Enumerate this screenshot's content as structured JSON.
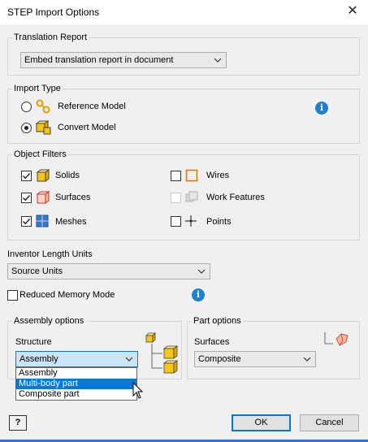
{
  "window": {
    "title": "STEP Import Options"
  },
  "translation_report": {
    "legend": "Translation Report",
    "selected": "Embed translation report in document"
  },
  "import_type": {
    "legend": "Import Type",
    "options": [
      {
        "label": "Reference Model",
        "selected": false
      },
      {
        "label": "Convert Model",
        "selected": true
      }
    ]
  },
  "object_filters": {
    "legend": "Object Filters",
    "items": [
      {
        "label": "Solids",
        "checked": true,
        "enabled": true
      },
      {
        "label": "Surfaces",
        "checked": true,
        "enabled": true
      },
      {
        "label": "Meshes",
        "checked": true,
        "enabled": true
      },
      {
        "label": "Wires",
        "checked": false,
        "enabled": true
      },
      {
        "label": "Work Features",
        "checked": false,
        "enabled": false
      },
      {
        "label": "Points",
        "checked": false,
        "enabled": true
      }
    ]
  },
  "length_units": {
    "label": "Inventor Length Units",
    "selected": "Source Units"
  },
  "reduced_memory": {
    "label": "Reduced Memory Mode",
    "checked": false
  },
  "assembly_options": {
    "legend": "Assembly options",
    "structure_label": "Structure",
    "selected": "Assembly",
    "dropdown_options": [
      "Assembly",
      "Multi-body part",
      "Composite part"
    ],
    "highlighted": "Multi-body part"
  },
  "part_options": {
    "legend": "Part options",
    "surfaces_label": "Surfaces",
    "selected": "Composite"
  },
  "buttons": {
    "help": "?",
    "ok": "OK",
    "cancel": "Cancel"
  },
  "colors": {
    "accent": "#0078d7",
    "icon_yellow": "#f5c518",
    "icon_orange": "#e07b00",
    "info_blue": "#1f7fd0"
  }
}
